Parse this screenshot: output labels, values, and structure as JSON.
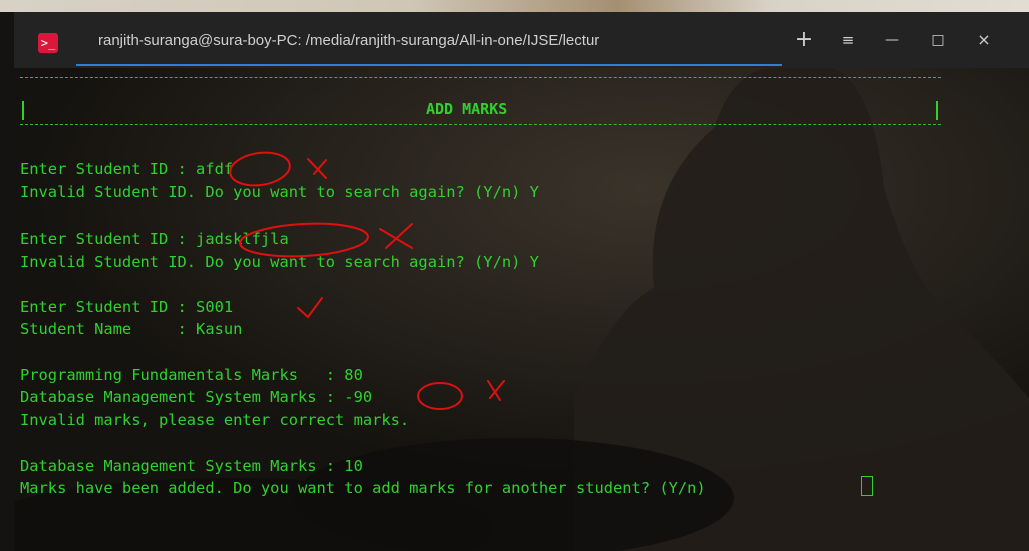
{
  "window": {
    "title": "ranjith-suranga@sura-boy-PC: /media/ranjith-suranga/All-in-one/IJSE/lectur",
    "app_icon_glyph": ">_",
    "buttons": {
      "new_tab": "+",
      "menu": "≡",
      "minimize": "—",
      "maximize": "□",
      "close": "×"
    }
  },
  "terminal": {
    "header": "ADD MARKS",
    "lines": [
      "Enter Student ID : afdf",
      "Invalid Student ID. Do you want to search again? (Y/n) Y",
      "Enter Student ID : jadsklfjla",
      "Invalid Student ID. Do you want to search again? (Y/n) Y",
      "Enter Student ID : S001",
      "Student Name     : Kasun",
      "Programming Fundamentals Marks   : 80",
      "Database Management System Marks : -90",
      "Invalid marks, please enter correct marks.",
      "Database Management System Marks : 10",
      "Marks have been added. Do you want to add marks for another student? (Y/n) "
    ]
  },
  "colors": {
    "terminal_text": "#2fd12f",
    "annotation": "#e01010",
    "tab_underline": "#2f7fd8"
  }
}
